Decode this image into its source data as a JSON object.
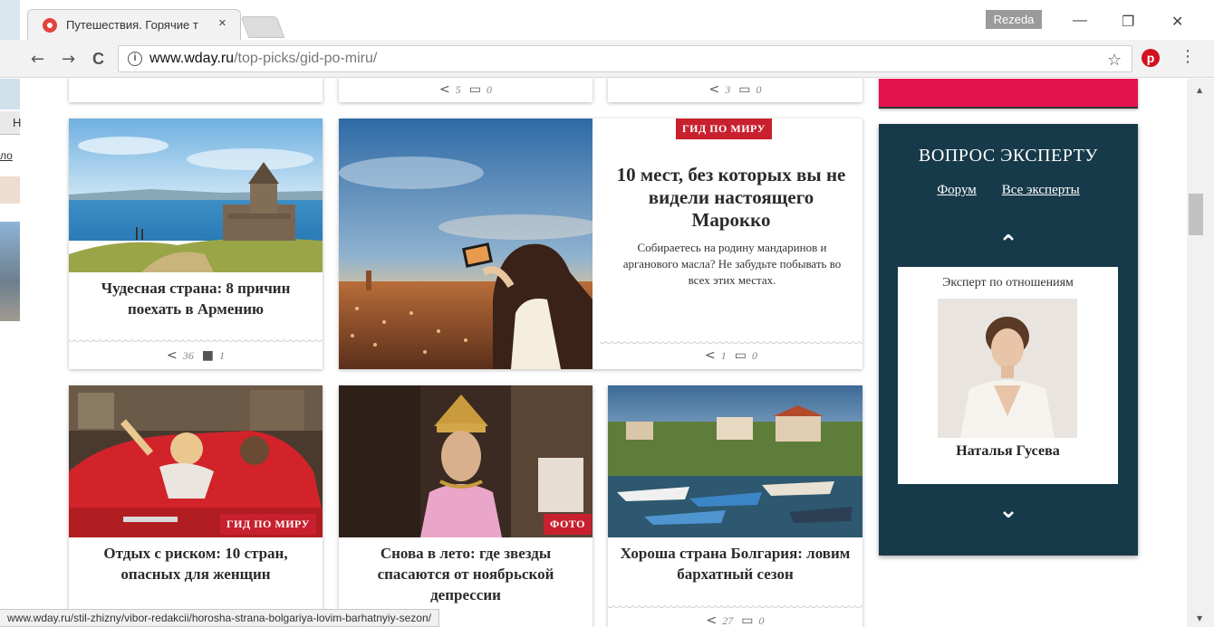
{
  "browser": {
    "tab_title": "Путешествия. Горячие т",
    "tab_close": "×",
    "profile_name": "Rezeda",
    "url_host": "www.wday.ru",
    "url_path": "/top-picks/gid-po-miru/",
    "info_glyph": "i",
    "pinterest_glyph": "p",
    "back": "←",
    "forward": "→",
    "reload": "C",
    "star": "☆",
    "menu": "⋮",
    "minimize": "—",
    "restore": "❐",
    "close": "✕"
  },
  "left_bleed": {
    "letter": "Н",
    "link_text": "ло"
  },
  "top_row": [
    {
      "shares": "5",
      "comments": "0"
    },
    {
      "shares": "3",
      "comments": "0"
    }
  ],
  "cards": [
    {
      "title": "Чудесная страна: 8 причин поехать в Армению",
      "shares": "36",
      "comments": "1"
    },
    {
      "badge": "ГИД ПО МИРУ",
      "title": "10 мест, без которых вы не видели настоящего Марокко",
      "description": "Собираетесь на родину мандаринов и арганового масла? Не забудьте побывать во всех этих местах.",
      "shares": "1",
      "comments": "0"
    },
    {
      "badge": "ГИД ПО МИРУ",
      "title": "Отдых с риском: 10 стран, опасных для женщин"
    },
    {
      "badge": "ФОТО",
      "title": "Снова в лето: где звезды спасаются от ноябрьской депрессии"
    },
    {
      "title": "Хороша страна Болгария: ловим бархатный сезон",
      "shares": "27",
      "comments": "0"
    }
  ],
  "expert": {
    "title": "ВОПРОС ЭКСПЕРТУ",
    "link_forum": "Форум",
    "link_all": "Все эксперты",
    "role": "Эксперт по отношениям",
    "name": "Наталья Гусева"
  },
  "statusbar": {
    "url": "www.wday.ru/stil-zhizny/vibor-redakcii/horosha-strana-bolgariya-lovim-barhatnyiy-sezon/"
  },
  "icons": {
    "share": "share-icon",
    "comment": "comment-icon"
  },
  "colors": {
    "badge_red": "#c8202e",
    "expert_bg": "#173a4a",
    "banner_pink": "#e4134e"
  }
}
